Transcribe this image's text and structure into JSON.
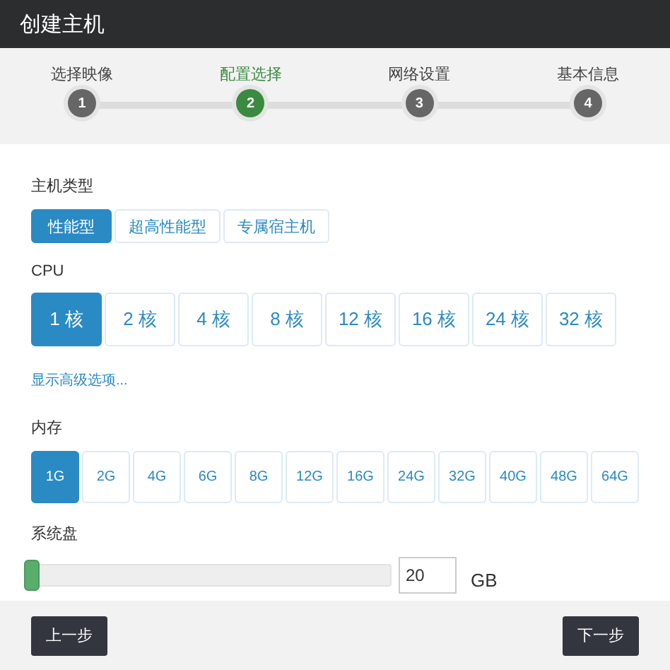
{
  "window": {
    "title": "创建主机"
  },
  "steps": [
    {
      "number": "1",
      "label": "选择映像",
      "selected": false
    },
    {
      "number": "2",
      "label": "配置选择",
      "selected": true
    },
    {
      "number": "3",
      "label": "网络设置",
      "selected": false
    },
    {
      "number": "4",
      "label": "基本信息",
      "selected": false
    }
  ],
  "host_type": {
    "label": "主机类型",
    "options": [
      {
        "label": "性能型",
        "selected": true
      },
      {
        "label": "超高性能型",
        "selected": false
      },
      {
        "label": "专属宿主机",
        "selected": false
      }
    ]
  },
  "cpu": {
    "label": "CPU",
    "options": [
      {
        "label": "1 核",
        "selected": true
      },
      {
        "label": "2 核",
        "selected": false
      },
      {
        "label": "4 核",
        "selected": false
      },
      {
        "label": "8 核",
        "selected": false
      },
      {
        "label": "12 核",
        "selected": false
      },
      {
        "label": "16 核",
        "selected": false
      },
      {
        "label": "24 核",
        "selected": false
      },
      {
        "label": "32 核",
        "selected": false
      }
    ]
  },
  "advanced_link": "显示高级选项...",
  "memory": {
    "label": "内存",
    "options": [
      {
        "label": "1G",
        "selected": true
      },
      {
        "label": "2G",
        "selected": false
      },
      {
        "label": "4G",
        "selected": false
      },
      {
        "label": "6G",
        "selected": false
      },
      {
        "label": "8G",
        "selected": false
      },
      {
        "label": "12G",
        "selected": false
      },
      {
        "label": "16G",
        "selected": false
      },
      {
        "label": "24G",
        "selected": false
      },
      {
        "label": "32G",
        "selected": false
      },
      {
        "label": "40G",
        "selected": false
      },
      {
        "label": "48G",
        "selected": false
      },
      {
        "label": "64G",
        "selected": false
      }
    ]
  },
  "system_disk": {
    "label": "系统盘",
    "level": 0,
    "value": "20",
    "unit": "GB"
  },
  "buttons": {
    "back": "上一步",
    "next": "下一步"
  }
}
